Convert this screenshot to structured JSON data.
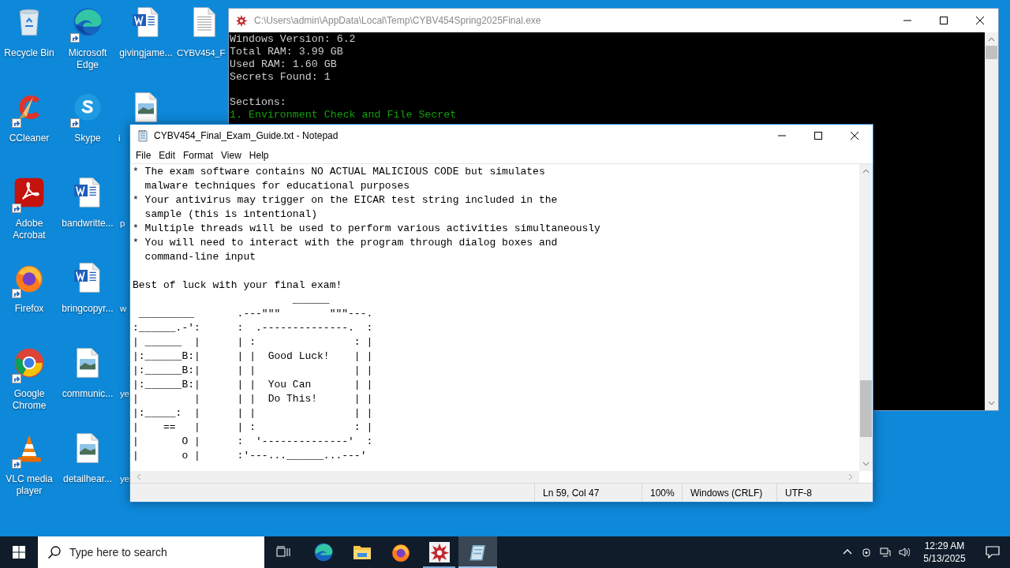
{
  "desktop": {
    "icons": [
      {
        "label": "Recycle Bin",
        "kind": "recycle-bin",
        "shortcut": false
      },
      {
        "label": "CCleaner",
        "kind": "ccleaner",
        "shortcut": true
      },
      {
        "label": "Adobe Acrobat",
        "kind": "acrobat",
        "shortcut": true
      },
      {
        "label": "Firefox",
        "kind": "firefox",
        "shortcut": true
      },
      {
        "label": "Google Chrome",
        "kind": "chrome",
        "shortcut": true
      },
      {
        "label": "VLC media player",
        "kind": "vlc",
        "shortcut": true
      },
      {
        "label": "Microsoft Edge",
        "kind": "edge",
        "shortcut": true
      },
      {
        "label": "Skype",
        "kind": "skype",
        "shortcut": true
      },
      {
        "label": "bandwritte...",
        "kind": "word",
        "shortcut": false
      },
      {
        "label": "bringcopyr...",
        "kind": "word",
        "shortcut": false
      },
      {
        "label": "communic...",
        "kind": "image",
        "shortcut": false
      },
      {
        "label": "detailhear...",
        "kind": "image",
        "shortcut": false
      },
      {
        "label": "givingjame...",
        "kind": "word",
        "shortcut": false
      },
      {
        "label": "i",
        "kind": "image",
        "shortcut": false,
        "cut": true
      },
      {
        "label": "p",
        "shortcut": false,
        "cut": true
      },
      {
        "label": "w",
        "shortcut": false,
        "cut": true
      },
      {
        "label": "ye",
        "shortcut": false,
        "cut": true
      },
      {
        "label": "ye",
        "shortcut": false,
        "cut": true
      },
      {
        "label": "CYBV454_F",
        "kind": "text",
        "shortcut": false,
        "cut": true
      }
    ]
  },
  "console": {
    "title": "C:\\Users\\admin\\AppData\\Local\\Temp\\CYBV454Spring2025Final.exe",
    "lines": [
      "Windows Version: 6.2",
      "Total RAM: 3.99 GB",
      "Used RAM: 1.60 GB",
      "Secrets Found: 1"
    ],
    "sections_heading": "Sections:",
    "sections": [
      "1. Environment Check and File Secret"
    ]
  },
  "notepad": {
    "title": "CYBV454_Final_Exam_Guide.txt - Notepad",
    "menu": [
      "File",
      "Edit",
      "Format",
      "View",
      "Help"
    ],
    "blocks": [
      [
        "* The exam software contains NO ACTUAL MALICIOUS CODE but simulates",
        "  malware techniques for educational purposes",
        "* Your antivirus may trigger on the EICAR test string included in the",
        "  sample (this is intentional)",
        "* Multiple threads will be used to perform various activities simultaneously",
        "* You will need to interact with the program through dialog boxes and",
        "  command-line input"
      ],
      [
        "Best of luck with your final exam!",
        "                          ______",
        " _________       .---\"\"\"        \"\"\"---.",
        ":______.-':      :  .--------------.  :",
        "| ______  |      | :                : |",
        "|:______B:|      | |  Good Luck!    | |",
        "|:______B:|      | |                | |",
        "|:______B:|      | |  You Can       | |",
        "|         |      | |  Do This!      | |",
        "|:_____:  |      | |                | |",
        "|    ==   |      | :                : |",
        "|       O |      :  '--------------'  :",
        "|       o |      :'---...______...---'"
      ]
    ],
    "status": [
      "Ln 59, Col 47",
      "100%",
      "Windows (CRLF)",
      "UTF-8"
    ]
  },
  "taskbar": {
    "search_placeholder": "Type here to search",
    "apps": [
      {
        "kind": "edge",
        "running": false,
        "active": false
      },
      {
        "kind": "explorer",
        "running": false,
        "active": false
      },
      {
        "kind": "firefox",
        "running": false,
        "active": false
      },
      {
        "kind": "splat",
        "running": true,
        "active": false
      },
      {
        "kind": "notepad",
        "running": true,
        "active": true
      }
    ],
    "time": "12:29 AM",
    "date": "5/13/2025"
  }
}
